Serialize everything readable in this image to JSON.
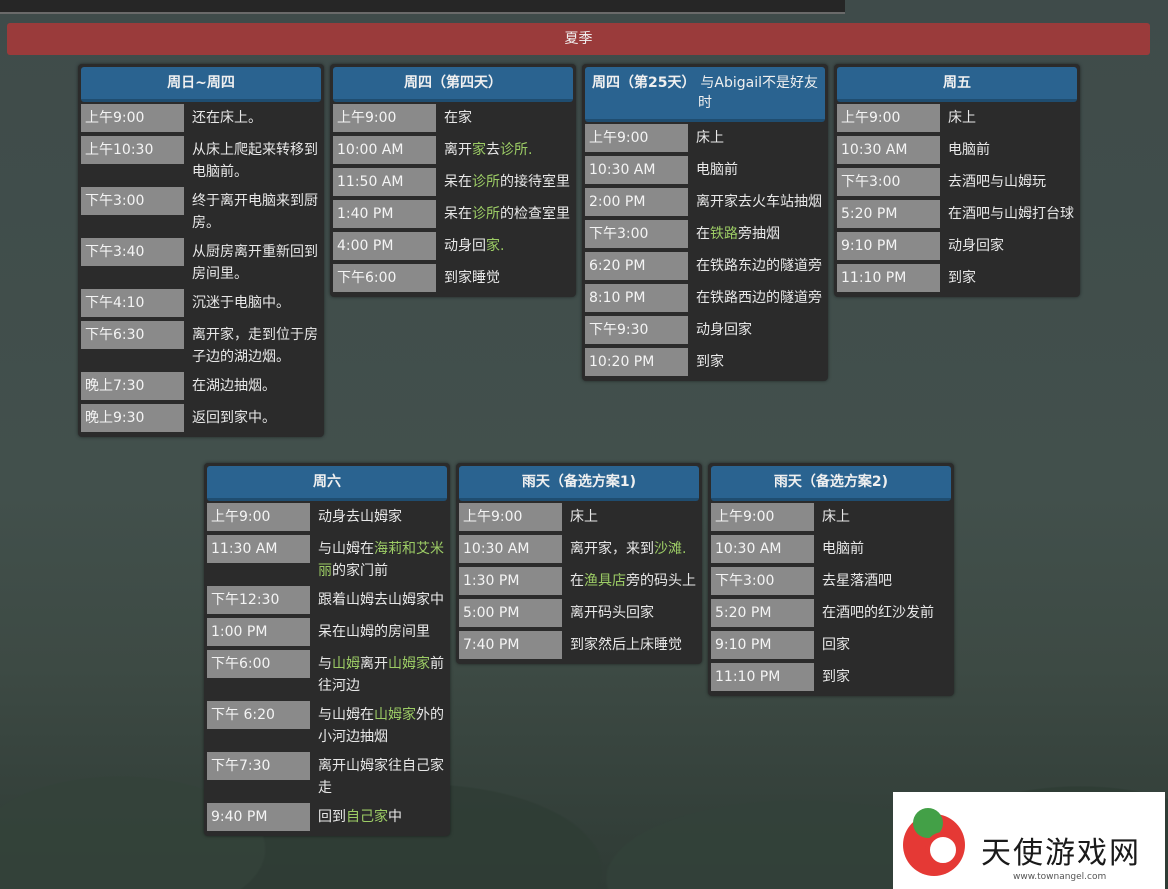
{
  "header": {
    "title": "夏季"
  },
  "cards": [
    {
      "title": "周日~周四",
      "rows": [
        {
          "time": "上午9:00",
          "desc": "还在床上。"
        },
        {
          "time": "上午10:30",
          "desc": "从床上爬起来转移到电脑前。"
        },
        {
          "time": "下午3:00",
          "desc": "终于离开电脑来到厨房。"
        },
        {
          "time": "下午3:40",
          "desc": "从厨房离开重新回到房间里。"
        },
        {
          "time": "下午4:10",
          "desc": "沉迷于电脑中。"
        },
        {
          "time": "下午6:30",
          "desc": "离开家，走到位于房子边的湖边烟。"
        },
        {
          "time": "晚上7:30",
          "desc": "在湖边抽烟。"
        },
        {
          "time": "晚上9:30",
          "desc": "返回到家中。"
        }
      ]
    },
    {
      "title": "周四（第四天）",
      "rows": [
        {
          "time": "上午9:00",
          "desc": "在家"
        },
        {
          "time": "10:00 AM",
          "parts": [
            {
              "t": "离开"
            },
            {
              "t": "家",
              "hl": true
            },
            {
              "t": "去"
            },
            {
              "t": "诊所.",
              "hl": true
            }
          ]
        },
        {
          "time": "11:50 AM",
          "parts": [
            {
              "t": "呆在"
            },
            {
              "t": "诊所",
              "hl": true
            },
            {
              "t": "的接待室里"
            }
          ]
        },
        {
          "time": "1:40 PM",
          "parts": [
            {
              "t": "呆在"
            },
            {
              "t": "诊所",
              "hl": true
            },
            {
              "t": "的检查室里"
            }
          ]
        },
        {
          "time": "4:00 PM",
          "parts": [
            {
              "t": "动身回"
            },
            {
              "t": "家.",
              "hl": true
            }
          ]
        },
        {
          "time": "下午6:00",
          "desc": "到家睡觉"
        }
      ]
    },
    {
      "title": "周四（第25天）",
      "title_sub": "与Abigail不是好友时",
      "rows": [
        {
          "time": "上午9:00",
          "desc": "床上"
        },
        {
          "time": "10:30 AM",
          "desc": "电脑前"
        },
        {
          "time": "2:00 PM",
          "desc": "离开家去火车站抽烟"
        },
        {
          "time": "下午3:00",
          "parts": [
            {
              "t": "在"
            },
            {
              "t": "铁路",
              "hl": true
            },
            {
              "t": "旁抽烟"
            }
          ]
        },
        {
          "time": "6:20 PM",
          "desc": "在铁路东边的隧道旁"
        },
        {
          "time": "8:10 PM",
          "desc": "在铁路西边的隧道旁"
        },
        {
          "time": "下午9:30",
          "desc": "动身回家"
        },
        {
          "time": "10:20 PM",
          "desc": "到家"
        }
      ]
    },
    {
      "title": "周五",
      "rows": [
        {
          "time": "上午9:00",
          "desc": "床上"
        },
        {
          "time": "10:30 AM",
          "desc": "电脑前"
        },
        {
          "time": "下午3:00",
          "desc": "去酒吧与山姆玩"
        },
        {
          "time": "5:20 PM",
          "desc": "在酒吧与山姆打台球"
        },
        {
          "time": "9:10 PM",
          "desc": "动身回家"
        },
        {
          "time": "11:10 PM",
          "desc": "到家"
        }
      ]
    },
    {
      "title": "周六",
      "rows": [
        {
          "time": "上午9:00",
          "desc": "动身去山姆家"
        },
        {
          "time": "11:30 AM",
          "parts": [
            {
              "t": "与山姆在"
            },
            {
              "t": "海莉和艾米丽",
              "hl": true
            },
            {
              "t": "的家门前"
            }
          ]
        },
        {
          "time": "下午12:30",
          "desc": "跟着山姆去山姆家中"
        },
        {
          "time": "1:00 PM",
          "desc": "呆在山姆的房间里"
        },
        {
          "time": "下午6:00",
          "parts": [
            {
              "t": "与"
            },
            {
              "t": "山姆",
              "hl": true
            },
            {
              "t": "离开"
            },
            {
              "t": "山姆家",
              "hl": true
            },
            {
              "t": "前往河边"
            }
          ]
        },
        {
          "time": "下午 6:20",
          "parts": [
            {
              "t": "与山姆在"
            },
            {
              "t": "山姆家",
              "hl": true
            },
            {
              "t": "外的小河边抽烟"
            }
          ]
        },
        {
          "time": "下午7:30",
          "desc": "离开山姆家往自己家走"
        },
        {
          "time": "9:40 PM",
          "parts": [
            {
              "t": "回到"
            },
            {
              "t": "自己家",
              "hl": true
            },
            {
              "t": "中"
            }
          ]
        }
      ]
    },
    {
      "title": "雨天（备选方案1)",
      "rows": [
        {
          "time": "上午9:00",
          "desc": "床上"
        },
        {
          "time": "10:30 AM",
          "parts": [
            {
              "t": "离开家，来到"
            },
            {
              "t": "沙滩.",
              "hl": true
            }
          ]
        },
        {
          "time": "1:30 PM",
          "parts": [
            {
              "t": "在"
            },
            {
              "t": "渔具店",
              "hl": true
            },
            {
              "t": "旁的码头上"
            }
          ]
        },
        {
          "time": "5:00 PM",
          "desc": "离开码头回家"
        },
        {
          "time": "7:40 PM",
          "desc": "到家然后上床睡觉"
        }
      ]
    },
    {
      "title": "雨天（备选方案2)",
      "rows": [
        {
          "time": "上午9:00",
          "desc": "床上"
        },
        {
          "time": "10:30 AM",
          "desc": "电脑前"
        },
        {
          "time": "下午3:00",
          "desc": "去星落酒吧"
        },
        {
          "time": "5:20 PM",
          "desc": "在酒吧的红沙发前"
        },
        {
          "time": "9:10 PM",
          "desc": "回家"
        },
        {
          "time": "11:10 PM",
          "desc": "到家"
        }
      ]
    }
  ],
  "watermark": {
    "text": "天使游戏网",
    "url": "www.townangel.com"
  }
}
